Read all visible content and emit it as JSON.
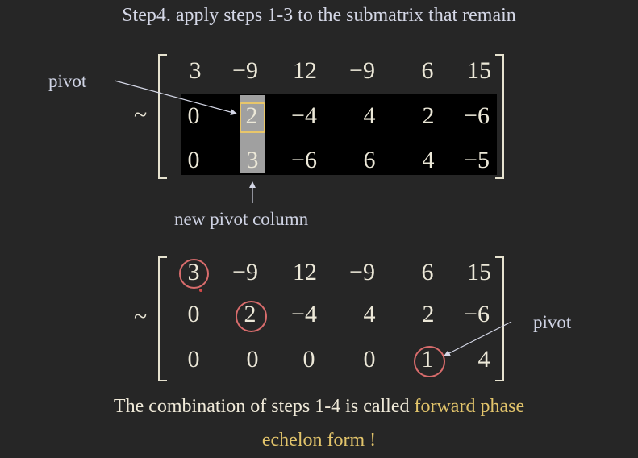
{
  "title": "Step4. apply steps 1-3 to the submatrix that remain",
  "labels": {
    "pivot_top": "pivot",
    "new_pivot_column": "new pivot column",
    "pivot_right": "pivot",
    "tilde": "~"
  },
  "matrix1": {
    "rows": [
      [
        "3",
        "−9",
        "12",
        "−9",
        "6",
        "15"
      ],
      [
        "0",
        "2",
        "−4",
        "4",
        "2",
        "−6"
      ],
      [
        "0",
        "3",
        "−6",
        "6",
        "4",
        "−5"
      ]
    ]
  },
  "matrix2": {
    "rows": [
      [
        "3",
        "−9",
        "12",
        "−9",
        "6",
        "15"
      ],
      [
        "0",
        "2",
        "−4",
        "4",
        "2",
        "−6"
      ],
      [
        "0",
        "0",
        "0",
        "0",
        "1",
        "4"
      ]
    ]
  },
  "footer": {
    "line1_prefix": "The combination of steps 1-4 is called ",
    "line1_highlight": "forward phase",
    "line2_highlight": "echelon form !"
  },
  "colors": {
    "background": "#262626",
    "highlight": "#e2c46b",
    "circle": "#d86c6c",
    "pivot_box": "#e8c66a"
  }
}
